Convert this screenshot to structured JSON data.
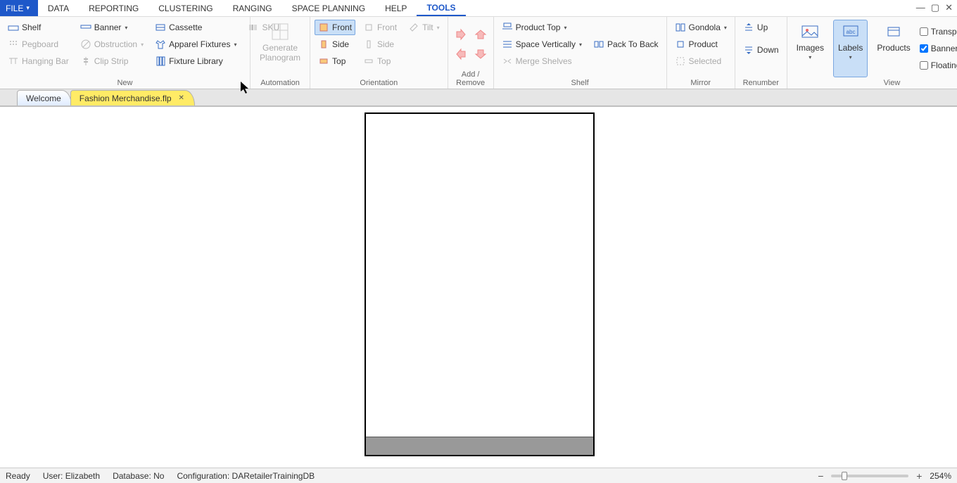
{
  "menubar": {
    "file": "FILE",
    "items": [
      "DATA",
      "REPORTING",
      "CLUSTERING",
      "RANGING",
      "SPACE PLANNING",
      "HELP",
      "TOOLS"
    ],
    "active_index": 6
  },
  "ribbon": {
    "new": {
      "label": "New",
      "shelf": "Shelf",
      "banner": "Banner",
      "cassette": "Cassette",
      "pegboard": "Pegboard",
      "obstruction": "Obstruction",
      "apparel": "Apparel Fixtures",
      "sku": "SKU",
      "hanging": "Hanging Bar",
      "clip": "Clip Strip",
      "fixture_lib": "Fixture Library"
    },
    "automation": {
      "label": "Automation",
      "generate": "Generate\nPlanogram"
    },
    "orientation": {
      "label": "Orientation",
      "front": "Front",
      "side": "Side",
      "top": "Top",
      "front2": "Front",
      "side2": "Side",
      "top2": "Top",
      "tilt": "Tilt"
    },
    "addremove": {
      "label": "Add / Remove"
    },
    "shelf": {
      "label": "Shelf",
      "product_top": "Product Top",
      "space_vert": "Space Vertically",
      "pack": "Pack To Back",
      "merge": "Merge Shelves"
    },
    "mirror": {
      "label": "Mirror",
      "gondola": "Gondola",
      "product": "Product",
      "selected": "Selected"
    },
    "renumber": {
      "label": "Renumber",
      "up": "Up",
      "down": "Down"
    },
    "view": {
      "label": "View",
      "images": "Images",
      "labels": "Labels",
      "products": "Products",
      "transparent": "Transparent Lab",
      "banners": "Banners",
      "floating": "Floating Status"
    }
  },
  "tabs": {
    "welcome": "Welcome",
    "file": "Fashion Merchandise.flp"
  },
  "status": {
    "ready": "Ready",
    "user_label": "User:",
    "user": "Elizabeth",
    "db_label": "Database:",
    "db": "No",
    "cfg_label": "Configuration:",
    "cfg": "DARetailerTrainingDB",
    "zoom": "254%"
  }
}
